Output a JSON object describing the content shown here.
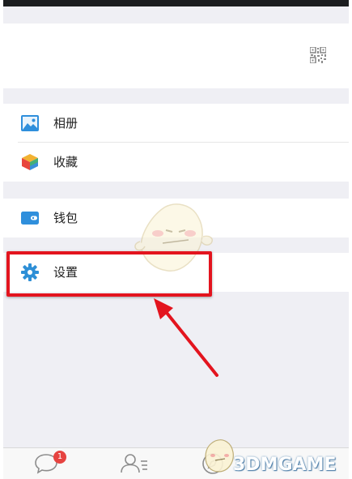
{
  "menu": {
    "album": {
      "label": "相册",
      "icon": "image-icon"
    },
    "favorites": {
      "label": "收藏",
      "icon": "cube-icon"
    },
    "wallet": {
      "label": "钱包",
      "icon": "wallet-icon"
    },
    "settings": {
      "label": "设置",
      "icon": "gear-icon"
    }
  },
  "tabbar": {
    "chats_badge": "1"
  },
  "watermark": {
    "logo_text": "3DMGAME"
  },
  "colors": {
    "background": "#efeff4",
    "highlight": "#e3141e",
    "badge": "#e64340",
    "settings_icon": "#2e8fd6"
  }
}
